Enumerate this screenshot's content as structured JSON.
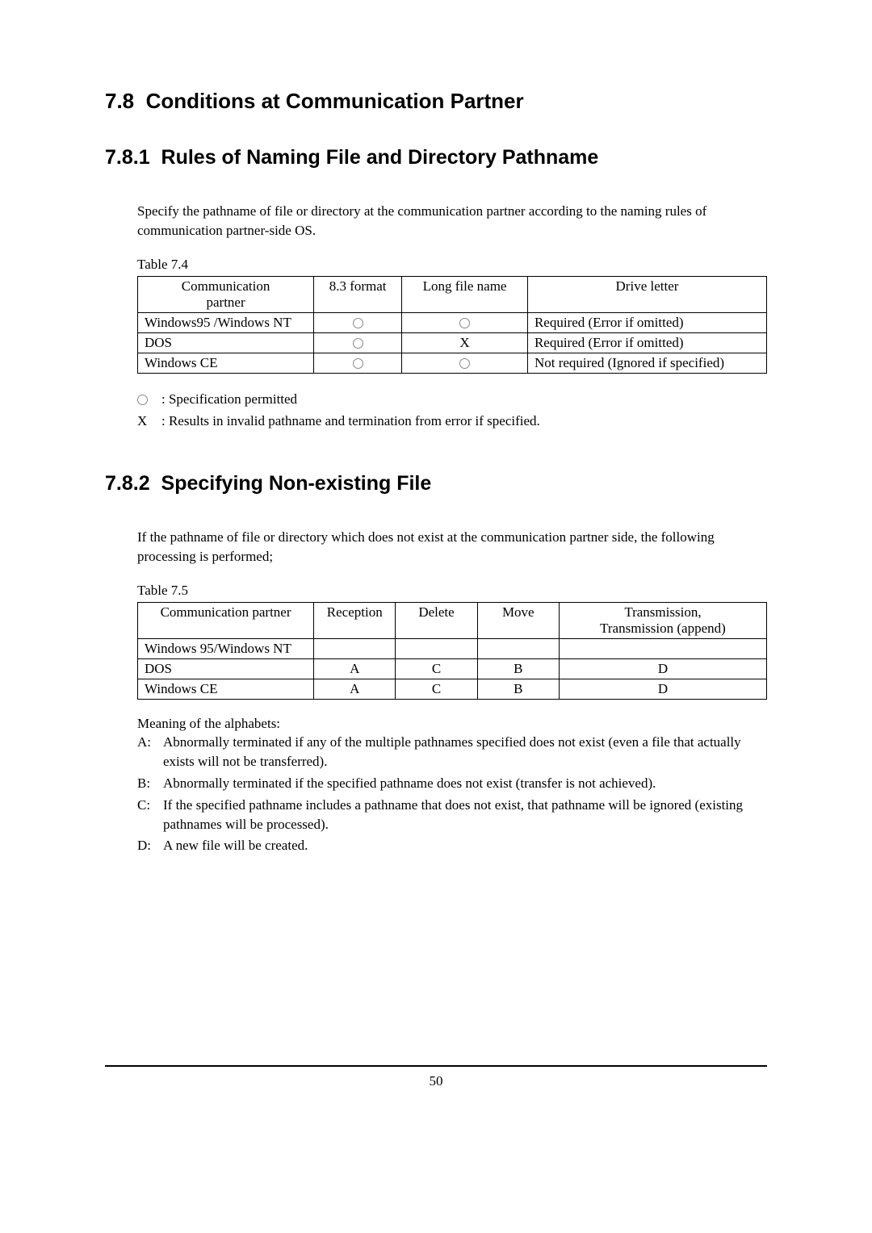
{
  "section": {
    "number": "7.8",
    "title": "Conditions at Communication Partner"
  },
  "sub1": {
    "number": "7.8.1",
    "title": "Rules of Naming File and Directory Pathname",
    "intro": "Specify the pathname of file or directory at the communication partner according to the naming rules of communication partner-side OS.",
    "table_caption": "Table 7.4",
    "headers": {
      "col1a": "Communication",
      "col1b": "partner",
      "col2": "8.3 format",
      "col3": "Long file name",
      "col4": "Drive letter"
    },
    "rows": [
      {
        "partner": "Windows95 /Windows NT",
        "fmt": "○",
        "longname": "○",
        "drive": "Required (Error if omitted)"
      },
      {
        "partner": "DOS",
        "fmt": "○",
        "longname": "X",
        "drive": "Required (Error if omitted)"
      },
      {
        "partner": "Windows CE",
        "fmt": "○",
        "longname": "○",
        "drive": "Not required (Ignored if specified)"
      }
    ],
    "legend": {
      "circle": ": Specification permitted",
      "x_label": "X",
      "x": ": Results in invalid pathname and termination from error if specified."
    }
  },
  "sub2": {
    "number": "7.8.2",
    "title": "Specifying Non-existing File",
    "intro": "If the pathname of file or directory which does not exist at the communication partner side, the following processing is performed;",
    "table_caption": "Table 7.5",
    "headers": {
      "col1": "Communication partner",
      "col2": "Reception",
      "col3": "Delete",
      "col4": "Move",
      "col5a": "Transmission,",
      "col5b": "Transmission (append)"
    },
    "rows": [
      {
        "partner": "Windows 95/Windows NT",
        "reception": "",
        "delete": "",
        "move": "",
        "trans": ""
      },
      {
        "partner": "DOS",
        "reception": "A",
        "delete": "C",
        "move": "B",
        "trans": "D"
      },
      {
        "partner": "Windows CE",
        "reception": "A",
        "delete": "C",
        "move": "B",
        "trans": "D"
      }
    ],
    "meanings_title": "Meaning of the alphabets:",
    "meanings": [
      {
        "label": "A:",
        "text": "Abnormally terminated if any of the multiple pathnames specified does not exist (even a file that actually exists will not be transferred)."
      },
      {
        "label": "B:",
        "text": "Abnormally terminated if the specified pathname does not exist (transfer is not achieved)."
      },
      {
        "label": "C:",
        "text": "If the specified pathname includes a pathname that does not exist, that pathname will be ignored (existing pathnames will be processed)."
      },
      {
        "label": "D:",
        "text": "A new file will be created."
      }
    ]
  },
  "page_number": "50"
}
